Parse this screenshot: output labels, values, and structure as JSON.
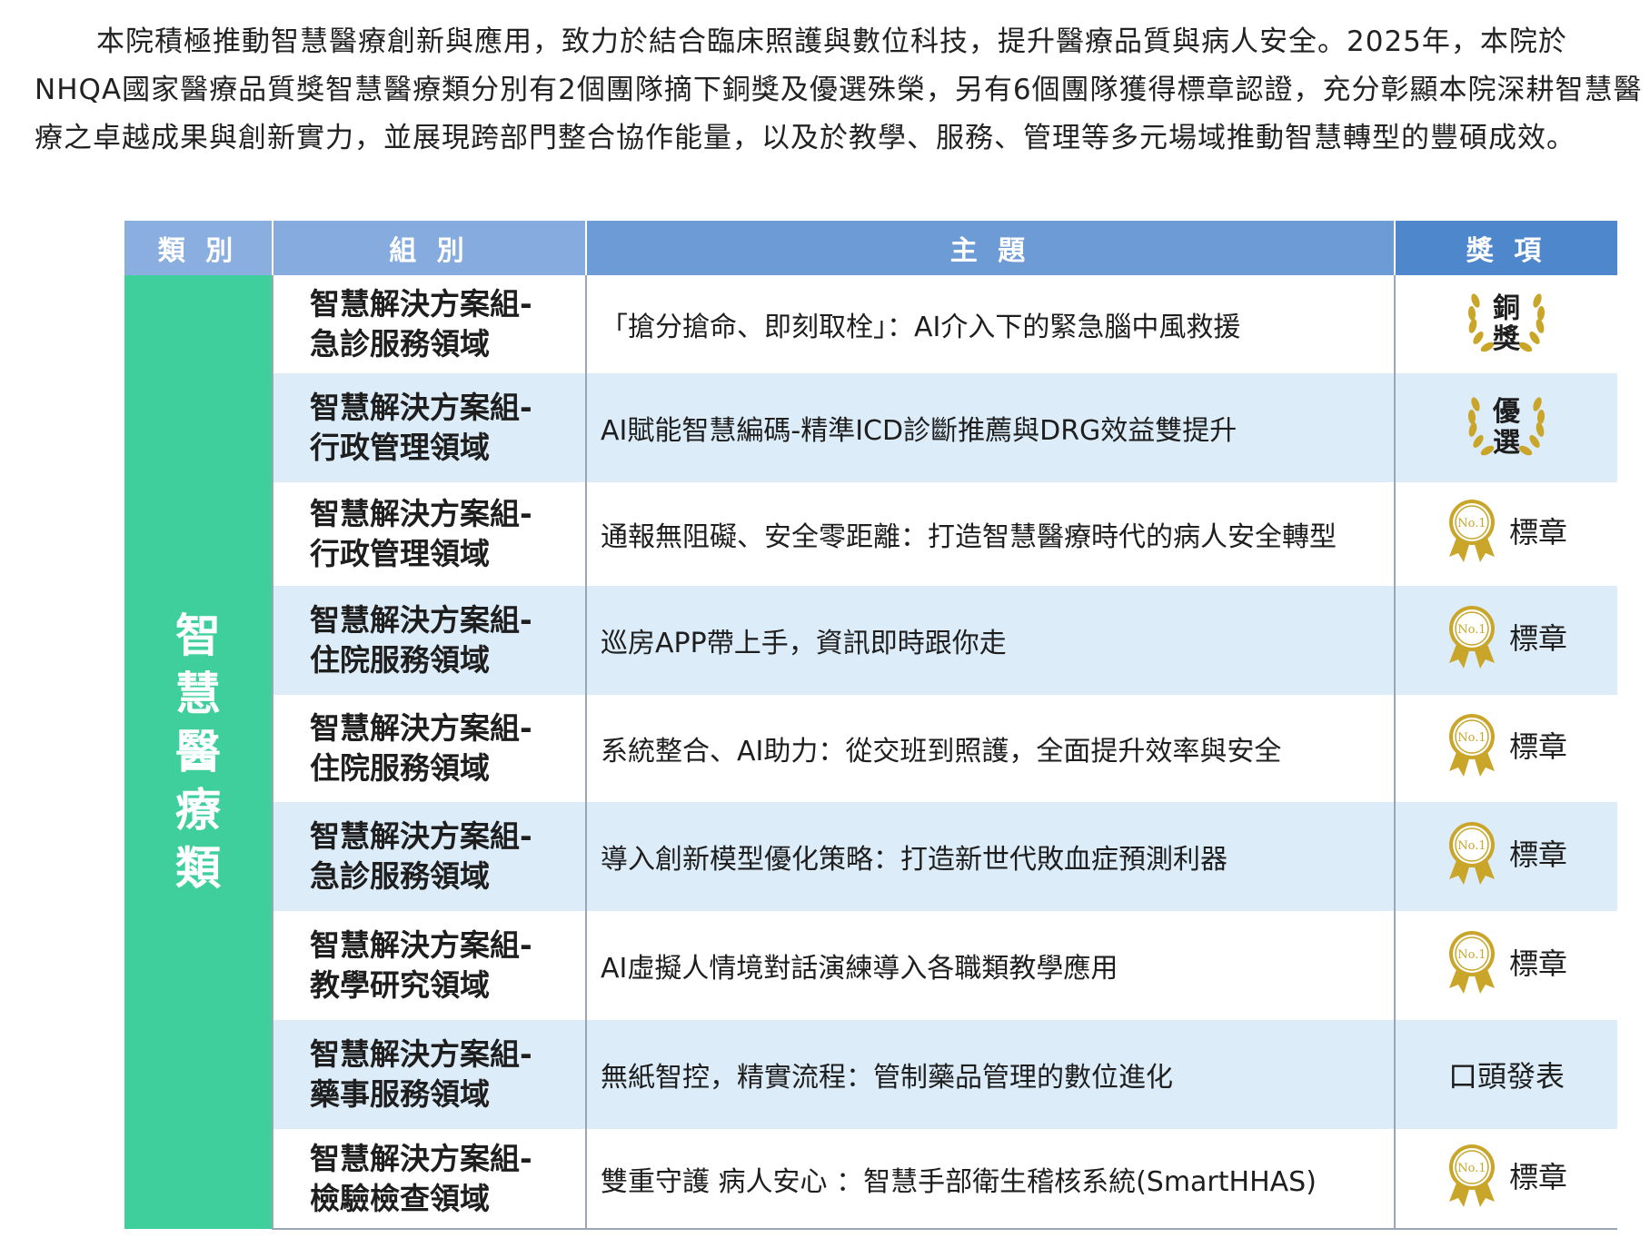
{
  "intro": {
    "text": "本院積極推動智慧醫療創新與應用，致力於結合臨床照護與數位科技，提升醫療品質與病人安全。2025年，本院於NHQA國家醫療品質獎智慧醫療類分別有2個團隊摘下銅獎及優選殊榮，另有6個團隊獲得標章認證，充分彰顯本院深耕智慧醫療之卓越成果與創新實力，並展現跨部門整合協作能量，以及於教學、服務、管理等多元場域推動智慧轉型的豐碩成效。"
  },
  "table": {
    "headers": {
      "category": "類 別",
      "group": "組 別",
      "topic": "主 題",
      "award": "獎 項"
    },
    "category": "智慧醫療類",
    "rows": [
      {
        "group_line1": "智慧解決方案組-",
        "group_line2": "急診服務領域",
        "topic": "「搶分搶命、即刻取栓」：AI介入下的緊急腦中風救援",
        "award": "銅獎",
        "award_char1": "銅",
        "award_char2": "獎",
        "award_icon": "bronze-wreath-icon"
      },
      {
        "group_line1": "智慧解決方案組-",
        "group_line2": "行政管理領域",
        "topic": "AI賦能智慧編碼-精準ICD診斷推薦與DRG效益雙提升",
        "award": "優選",
        "award_char1": "優",
        "award_char2": "選",
        "award_icon": "merit-wreath-icon"
      },
      {
        "group_line1": "智慧解決方案組-",
        "group_line2": "行政管理領域",
        "topic": "通報無阻礙、安全零距離：打造智慧醫療時代的病人安全轉型",
        "award": "標章",
        "badge_text": "No.1",
        "award_icon": "medal-icon"
      },
      {
        "group_line1": "智慧解決方案組-",
        "group_line2": "住院服務領域",
        "topic": "巡房APP帶上手，資訊即時跟你走",
        "award": "標章",
        "badge_text": "No.1",
        "award_icon": "medal-icon"
      },
      {
        "group_line1": "智慧解決方案組-",
        "group_line2": "住院服務領域",
        "topic": "系統整合、AI助力：從交班到照護，全面提升效率與安全",
        "award": "標章",
        "badge_text": "No.1",
        "award_icon": "medal-icon"
      },
      {
        "group_line1": "智慧解決方案組-",
        "group_line2": "急診服務領域",
        "topic": "導入創新模型優化策略：打造新世代敗血症預測利器",
        "award": "標章",
        "badge_text": "No.1",
        "award_icon": "medal-icon"
      },
      {
        "group_line1": "智慧解決方案組-",
        "group_line2": "教學研究領域",
        "topic": "AI虛擬人情境對話演練導入各職類教學應用",
        "award": "標章",
        "badge_text": "No.1",
        "award_icon": "medal-icon"
      },
      {
        "group_line1": "智慧解決方案組-",
        "group_line2": "藥事服務領域",
        "topic": "無紙智控，精實流程：管制藥品管理的數位進化",
        "award": "口頭發表"
      },
      {
        "group_line1": "智慧解決方案組-",
        "group_line2": "檢驗檢查領域",
        "topic": "雙重守護 病人安心 ：智慧手部衛生稽核系統(SmartHHAS)",
        "award": "標章",
        "badge_text": "No.1",
        "award_icon": "medal-icon"
      }
    ]
  },
  "colors": {
    "category_green": "#3ecf9c",
    "header_blue": "#6c9bd6",
    "row_alt_blue": "#dcecf8",
    "gold": "#c9a52a"
  }
}
